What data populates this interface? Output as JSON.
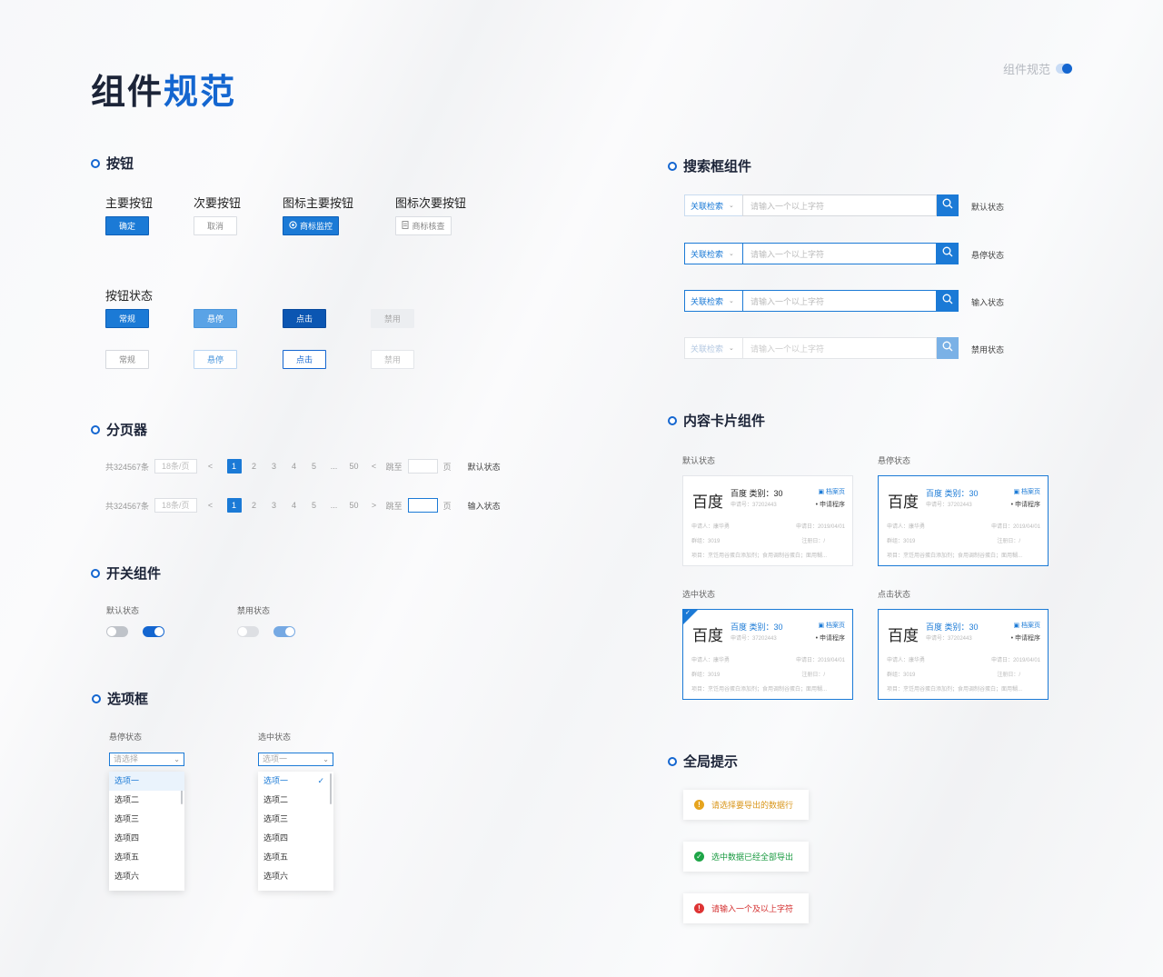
{
  "header": {
    "title_a": "组件",
    "title_b": "规范",
    "tag": "组件规范"
  },
  "buttons": {
    "section": "按钮",
    "types": [
      "主要按钮",
      "次要按钮",
      "图标主要按钮",
      "图标次要按钮"
    ],
    "confirm": "确定",
    "cancel": "取消",
    "icon_primary": "商标监控",
    "icon_secondary": "商标核查",
    "states_title": "按钮状态",
    "states": [
      "常规",
      "悬停",
      "点击",
      "禁用"
    ]
  },
  "pagination": {
    "section": "分页器",
    "total": "共324567条",
    "per_page": "18条/页",
    "prev": "<",
    "next": ">",
    "pages": [
      "1",
      "2",
      "3",
      "4",
      "5",
      "...",
      "50"
    ],
    "jump": "跳至",
    "page_unit": "页",
    "state_default": "默认状态",
    "state_input": "输入状态"
  },
  "switch": {
    "section": "开关组件",
    "default_label": "默认状态",
    "disabled_label": "禁用状态"
  },
  "select": {
    "section": "选项框",
    "hover_label": "悬停状态",
    "selected_label": "选中状态",
    "hover_placeholder": "请选择",
    "selected_value": "选项一",
    "options": [
      "选项一",
      "选项二",
      "选项三",
      "选项四",
      "选项五",
      "选项六"
    ]
  },
  "search": {
    "section": "搜索框组件",
    "category": "关联检索",
    "placeholder": "请输入一个以上字符",
    "states": [
      "默认状态",
      "悬停状态",
      "输入状态",
      "禁用状态"
    ]
  },
  "cards": {
    "section": "内容卡片组件",
    "labels": [
      "默认状态",
      "悬停状态",
      "选中状态",
      "点击状态"
    ],
    "logo": "百度",
    "name": "百度  类别：30",
    "reg": "申请号：37202443",
    "archive": "档案页",
    "process": "• 申请程序",
    "applicant": "申请人：康华勇",
    "date": "申请日：2019/04/01",
    "group": "群组：3019",
    "reg_date": "注册日：/",
    "items": "项目：烹饪用谷蛋白添加剂；食用调制谷蛋白；面用糊..."
  },
  "toasts": {
    "section": "全局提示",
    "warning": "请选择要导出的数据行",
    "success": "选中数据已经全部导出",
    "error": "请输入一个及以上字符",
    "colors": {
      "warning": "#e6a41e",
      "success": "#1ea547",
      "error": "#de3434"
    }
  }
}
